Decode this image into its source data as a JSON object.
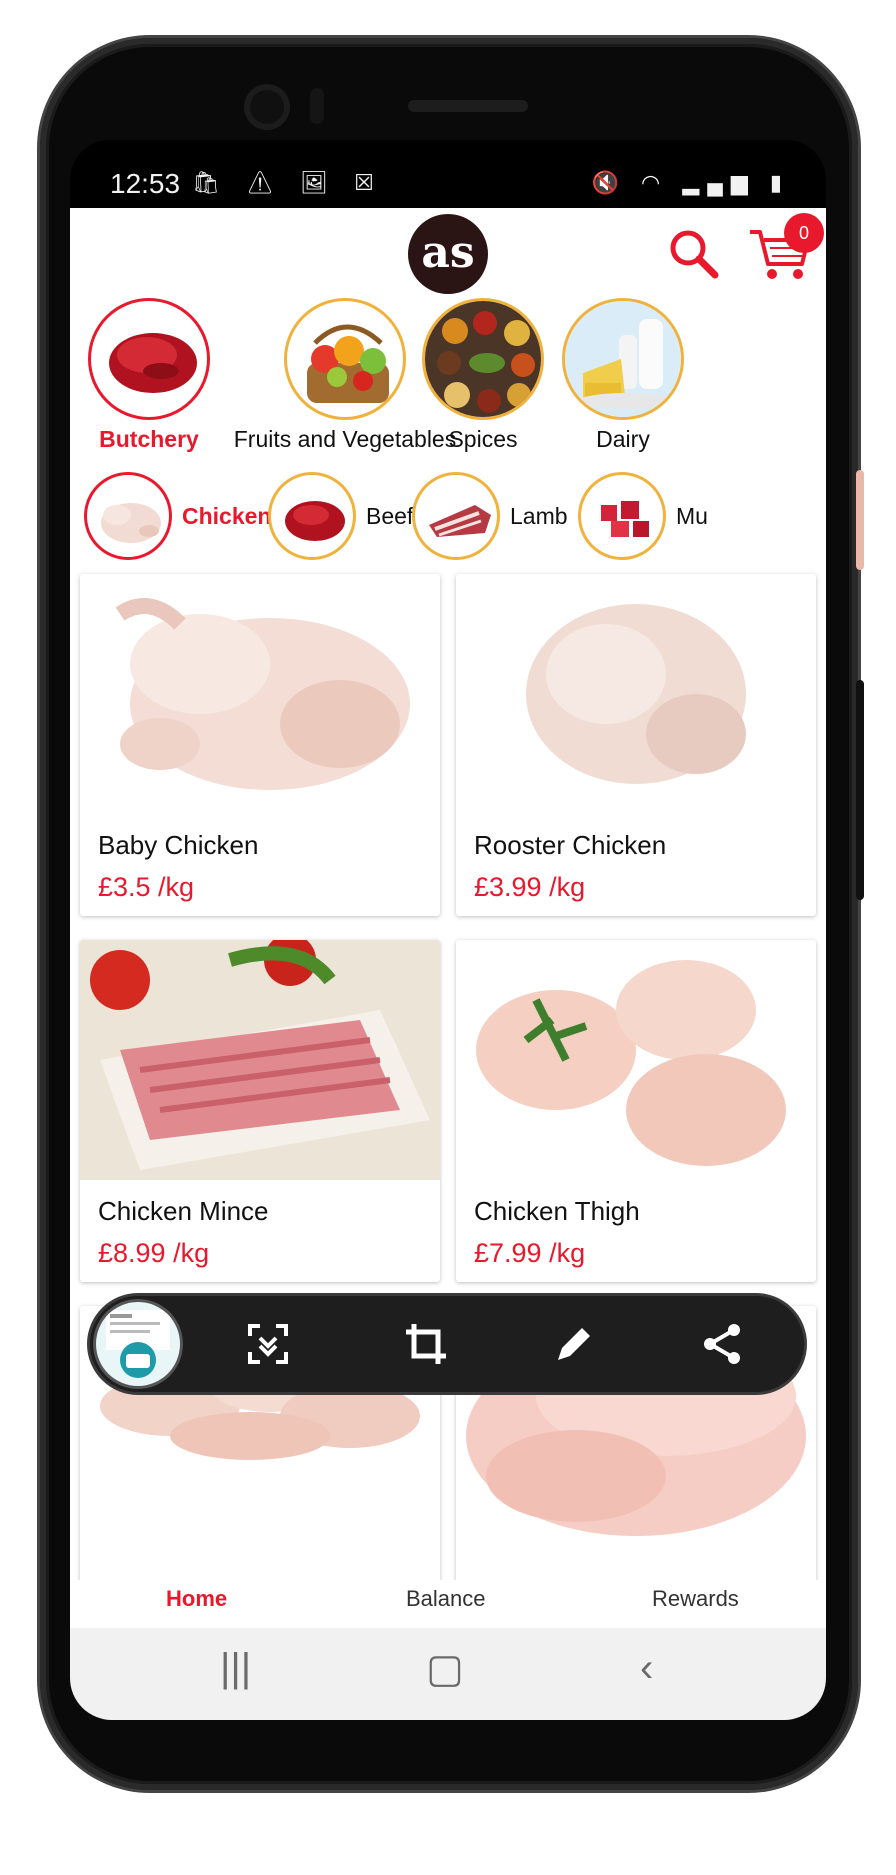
{
  "status_bar": {
    "time": "12:53",
    "left_icons": "🛍 ⚠ 🖼 ☒",
    "right_icons": "🔇 ◠ ▂▄▆ ▮"
  },
  "header": {
    "logo_text": "as",
    "cart_count": "0"
  },
  "categories": [
    {
      "label": "Butchery",
      "active": true,
      "icon": "red-meat-image"
    },
    {
      "label": "Fruits and Vegetables",
      "active": false,
      "icon": "fruit-basket-image"
    },
    {
      "label": "Spices",
      "active": false,
      "icon": "spices-image"
    },
    {
      "label": "Dairy",
      "active": false,
      "icon": "dairy-image"
    }
  ],
  "subcategories": [
    {
      "label": "Chicken",
      "active": true
    },
    {
      "label": "Beef",
      "active": false
    },
    {
      "label": "Lamb",
      "active": false
    },
    {
      "label": "Mu",
      "active": false
    }
  ],
  "products": [
    {
      "name": "Baby Chicken",
      "price": "£3.5 /kg"
    },
    {
      "name": "Rooster Chicken",
      "price": "£3.99 /kg"
    },
    {
      "name": "Chicken Mince",
      "price": "£8.99 /kg"
    },
    {
      "name": "Chicken Thigh",
      "price": "£7.99 /kg"
    },
    {
      "name": "",
      "price": ""
    },
    {
      "name": "",
      "price": ""
    }
  ],
  "bottom_nav": {
    "home": "Home",
    "balance": "Balance",
    "rewards": "Rewards"
  },
  "colors": {
    "accent": "#e8192c",
    "ring": "#f0b23c",
    "logo_bg": "#2b1414"
  }
}
